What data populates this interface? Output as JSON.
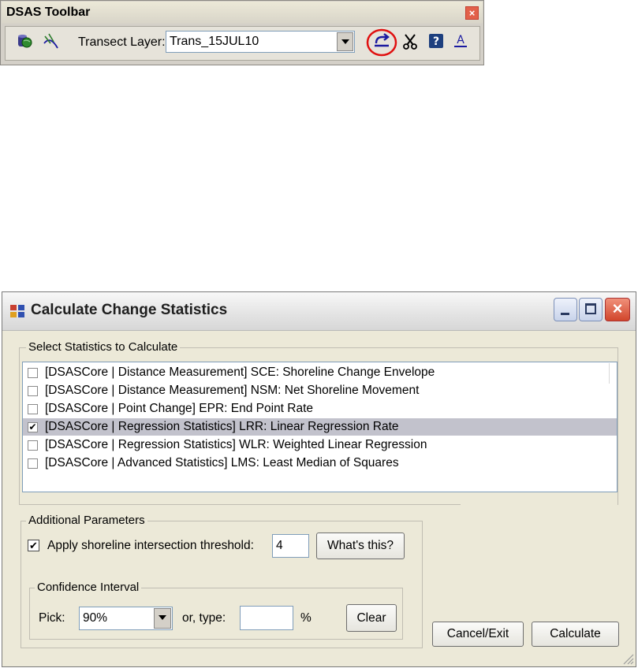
{
  "toolbar": {
    "title": "DSAS Toolbar",
    "close_icon": "close-icon",
    "transect_label": "Transect Layer:",
    "transect_value": "Trans_15JUL10",
    "icons": [
      "database-globe-icon",
      "cast-transects-icon",
      "calculate-rates-icon",
      "clip-scissors-icon",
      "help-icon",
      "text-style-icon"
    ]
  },
  "dialog": {
    "title": "Calculate Change Statistics",
    "select_group_label": "Select Statistics to Calculate",
    "stats": [
      {
        "label": "[DSASCore | Distance Measurement] SCE: Shoreline Change Envelope",
        "checked": false
      },
      {
        "label": "[DSASCore | Distance Measurement] NSM: Net Shoreline Movement",
        "checked": false
      },
      {
        "label": "[DSASCore | Point Change] EPR: End Point Rate",
        "checked": false
      },
      {
        "label": "[DSASCore | Regression Statistics] LRR: Linear Regression Rate",
        "checked": true
      },
      {
        "label": "[DSASCore | Regression Statistics] WLR: Weighted Linear Regression",
        "checked": false
      },
      {
        "label": "[DSASCore | Advanced Statistics] LMS: Least Median of Squares",
        "checked": false
      }
    ],
    "params": {
      "group_label": "Additional Parameters",
      "threshold_label": "Apply shoreline intersection threshold:",
      "threshold_checked": true,
      "threshold_value": "4",
      "whats_this": "What's this?",
      "ci_group_label": "Confidence Interval",
      "pick_label": "Pick:",
      "pick_value": "90%",
      "or_type_label": "or, type:",
      "type_value": "",
      "percent": "%",
      "clear": "Clear"
    },
    "cancel": "Cancel/Exit",
    "calculate": "Calculate"
  }
}
